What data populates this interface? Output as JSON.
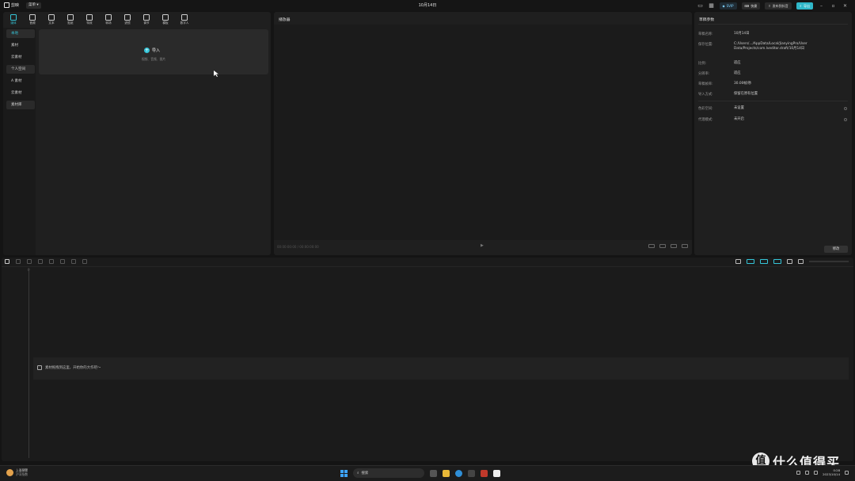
{
  "app": {
    "name": "剪映",
    "menu_label": "菜单",
    "project_title": "10月14日"
  },
  "titlebar_actions": {
    "vip_label": "SVIP",
    "shortcut_label": "快捷",
    "publish_label": "发布到抖音",
    "export_label": "导出"
  },
  "media_tools": [
    {
      "label": "媒体",
      "icon": "media-icon"
    },
    {
      "label": "音频",
      "icon": "audio-icon"
    },
    {
      "label": "文本",
      "icon": "text-icon"
    },
    {
      "label": "贴纸",
      "icon": "sticker-icon"
    },
    {
      "label": "特效",
      "icon": "effects-icon"
    },
    {
      "label": "转场",
      "icon": "transition-icon"
    },
    {
      "label": "滤镜",
      "icon": "filter-icon"
    },
    {
      "label": "调节",
      "icon": "adjust-icon"
    },
    {
      "label": "模板",
      "icon": "template-icon"
    },
    {
      "label": "数字人",
      "icon": "avatar-icon"
    }
  ],
  "media_nav": [
    {
      "label": "本地"
    },
    {
      "label": "素材"
    },
    {
      "label": "云素材"
    },
    {
      "label": "个人空间"
    },
    {
      "label": "A 素材"
    },
    {
      "label": "云素材"
    },
    {
      "label": "素材库"
    }
  ],
  "import": {
    "label": "导入",
    "hint": "视频、音频、图片"
  },
  "player": {
    "title": "播放器",
    "timecode": "00:00:00:00 / 00:00:00:00"
  },
  "details": {
    "title": "草稿参数",
    "rows": [
      {
        "key": "草稿名称:",
        "value": "10月14日"
      },
      {
        "key": "保存位置:",
        "value": "C:/Users/.../AppData/Local/JianyingPro/User Data/Projects/com.lveditor.draft/10月14日"
      },
      {
        "key": "比例:",
        "value": "适应"
      },
      {
        "key": "分辨率:",
        "value": "适应"
      },
      {
        "key": "草稿帧率:",
        "value": "30.00帧/秒"
      },
      {
        "key": "导入方式:",
        "value": "保留在原有位置"
      }
    ],
    "rows2": [
      {
        "key": "色彩空间:",
        "value": "未设置"
      },
      {
        "key": "代理模式:",
        "value": "未开启"
      }
    ],
    "edit_label": "修改"
  },
  "timeline": {
    "ruler_zero": "0",
    "hint": "素材拖拽到这里，开始你的大作吧～"
  },
  "taskbar": {
    "weather_title": "上涨预警",
    "weather_sub": "沪深指数",
    "search_placeholder": "搜索",
    "time": "0:28",
    "date": "2023/10/14"
  },
  "watermark": {
    "symbol": "值",
    "text": "什么值得买"
  }
}
